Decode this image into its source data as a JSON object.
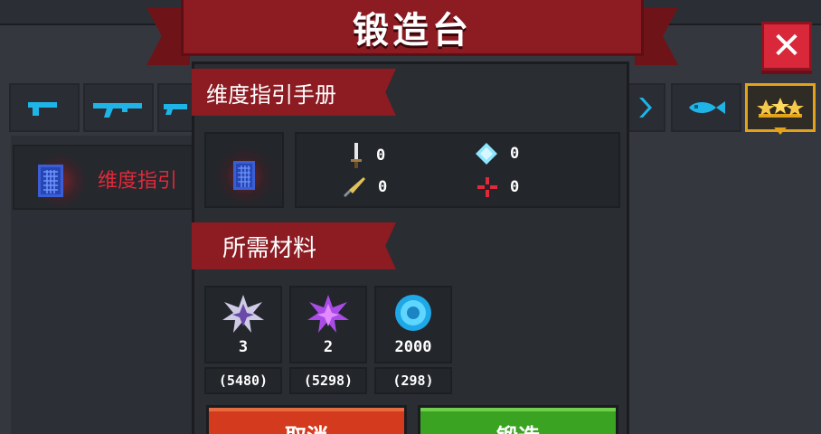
{
  "window": {
    "title": "锻造台",
    "close_label": "✕"
  },
  "weapon_tabs": [
    {
      "icon": "pistol-icon",
      "color": "#1fb4e8",
      "active": false
    },
    {
      "icon": "rifle-icon",
      "color": "#1fb4e8",
      "active": false
    },
    {
      "icon": "shotgun-icon",
      "color": "#1fb4e8",
      "active": false
    },
    {
      "icon": "bow-icon",
      "color": "#1fb4e8",
      "active": false
    },
    {
      "icon": "fish-icon",
      "color": "#1fb4e8",
      "active": false
    },
    {
      "icon": "crown-stars-icon",
      "color": "#e3a21a",
      "active": true
    }
  ],
  "item_list": [
    {
      "name": "维度指引",
      "icon": "book-icon",
      "selected": true
    }
  ],
  "detail": {
    "section_title": "维度指引手册",
    "stats": [
      {
        "icon": "sword-icon",
        "value": "0"
      },
      {
        "icon": "diamond-icon",
        "value": "0"
      },
      {
        "icon": "knife-icon",
        "value": "0"
      },
      {
        "icon": "crosshair-icon",
        "value": "0"
      }
    ]
  },
  "materials": {
    "section_title": "所需材料",
    "items": [
      {
        "icon": "white-crystal-shard-icon",
        "required": "3",
        "owned": "(5480)"
      },
      {
        "icon": "purple-crystal-shard-icon",
        "required": "2",
        "owned": "(5298)"
      },
      {
        "icon": "blue-gem-coin-icon",
        "required": "2000",
        "owned": "(298)"
      }
    ]
  },
  "buttons": {
    "cancel_label": "取消",
    "forge_label": "锻造"
  },
  "colors": {
    "ribbon": "#8c1b22",
    "accent_gold": "#e3a21a",
    "cancel": "#d33a1e",
    "forge": "#3aa321",
    "highlight_text": "#e0293a"
  }
}
